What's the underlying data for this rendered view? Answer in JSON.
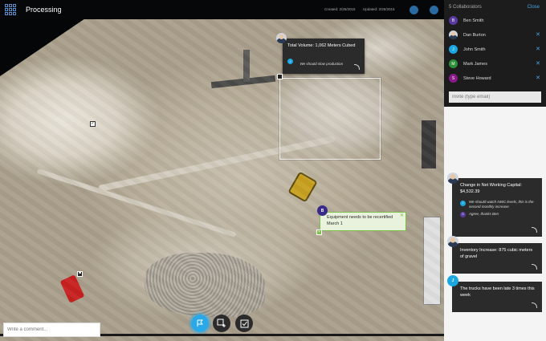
{
  "header": {
    "title": "Processing",
    "created": "Created: 2/25/2015",
    "updated": "Updated: 2/25/2015"
  },
  "map_popup": {
    "title": "Total Volume: 1,062 Meters Cubed",
    "reply_avatar": "J",
    "reply_text": "We should slow production"
  },
  "green_popup": {
    "avatar": "B",
    "text": "Equipment needs to be recertified March 1",
    "close": "✕"
  },
  "toolbar": {
    "flag_icon": "flag-icon",
    "add_area_icon": "add-area-icon",
    "checklist_icon": "checklist-icon"
  },
  "collaborators": {
    "title": "5 Collaborators",
    "close_label": "Close",
    "people": [
      {
        "name": "Ben Smith",
        "initial": "B",
        "color": "#5a3aa0",
        "removable": false
      },
      {
        "name": "Dan Burton",
        "initial": "",
        "color": "#cfd6de",
        "removable": true
      },
      {
        "name": "John Smith",
        "initial": "J",
        "color": "#1aa6e0",
        "removable": true
      },
      {
        "name": "Mark James",
        "initial": "M",
        "color": "#2e8f3a",
        "removable": true
      },
      {
        "name": "Steve Howard",
        "initial": "S",
        "color": "#8a1a8a",
        "removable": true
      }
    ],
    "invite_placeholder": "Invite (type email)"
  },
  "comments": [
    {
      "title": "Change in Net Working Capital: $4,532.39",
      "replies": [
        {
          "initial": "J",
          "color": "#1aa6e0",
          "text": "We should watch NWC levels, this is the second monthly increase"
        },
        {
          "initial": "S",
          "color": "#5a3aa0",
          "text": "Agree, thanks Ben"
        }
      ]
    },
    {
      "title": "Inventory Increase: 875 cubic meters of gravel"
    },
    {
      "title": "The trucks have been late 3 times this week",
      "avatar": "J"
    }
  ],
  "comment_input_placeholder": "Write a comment..."
}
